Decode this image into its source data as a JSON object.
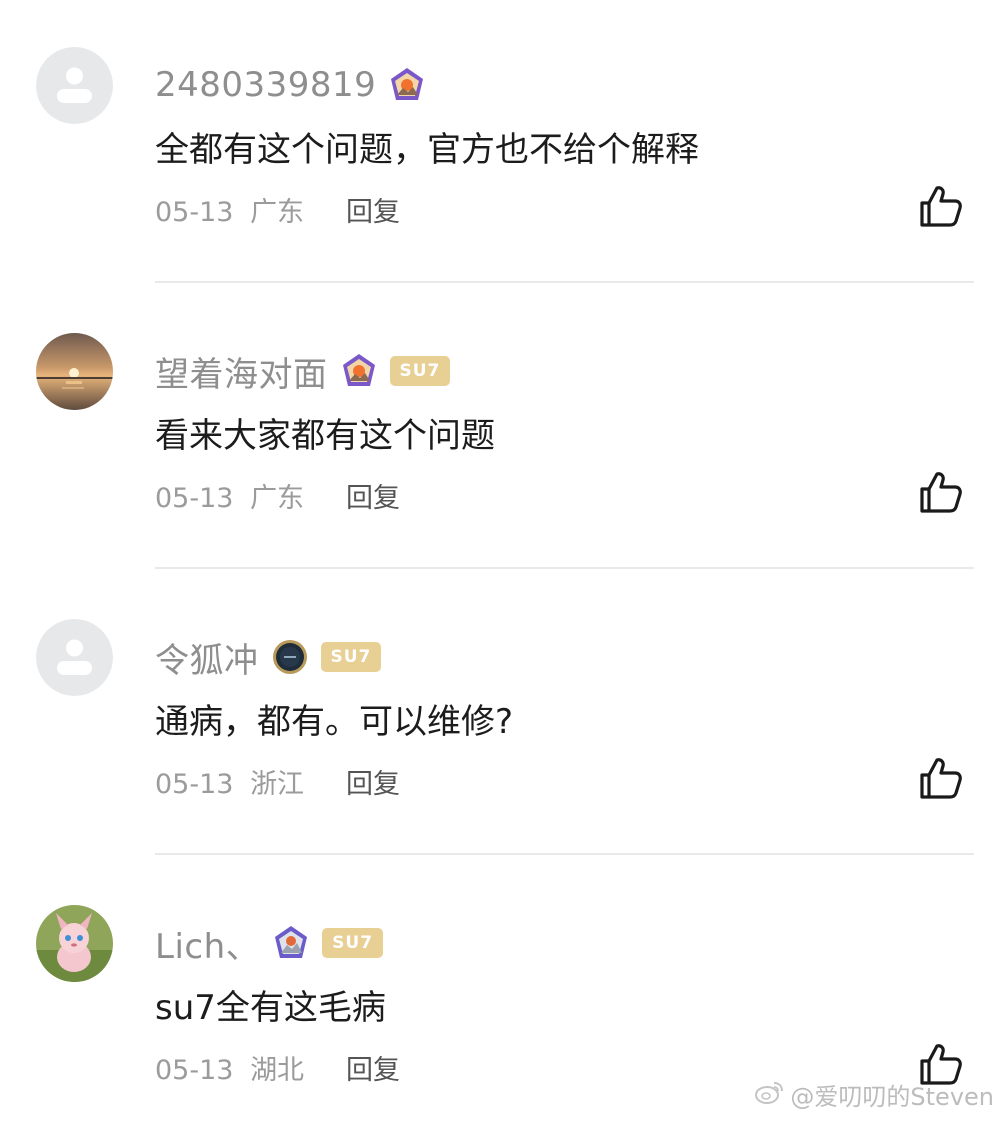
{
  "comments": [
    {
      "username": "2480339819",
      "avatar": "default-avatar",
      "badge": "purple-sunset-medal",
      "tag": "",
      "text": "全都有这个问题，官方也不给个解释",
      "date": "05-13",
      "region": "广东",
      "reply_label": "回复"
    },
    {
      "username": "望着海对面",
      "avatar": "sunset-sea-photo",
      "badge": "purple-sunset-medal",
      "tag": "SU7",
      "text": "看来大家都有这个问题",
      "date": "05-13",
      "region": "广东",
      "reply_label": "回复"
    },
    {
      "username": "令狐冲",
      "avatar": "default-avatar",
      "badge": "dark-su7-medal",
      "tag": "SU7",
      "text": "通病，都有。可以维修?",
      "date": "05-13",
      "region": "浙江",
      "reply_label": "回复"
    },
    {
      "username": "Lich、",
      "avatar": "cartoon-cat-avatar",
      "badge": "purple-mountain-medal",
      "tag": "SU7",
      "text": "su7全有这毛病",
      "date": "05-13",
      "region": "湖北",
      "reply_label": "回复"
    }
  ],
  "watermark": {
    "text": "@爱叨叨的Steven",
    "icon": "weibo-icon"
  },
  "colors": {
    "username": "#8e8e8e",
    "text": "#1c1c1c",
    "meta": "#9b9b9b",
    "tag_bg": "#e8cf94",
    "divider": "#e9e9e9"
  }
}
